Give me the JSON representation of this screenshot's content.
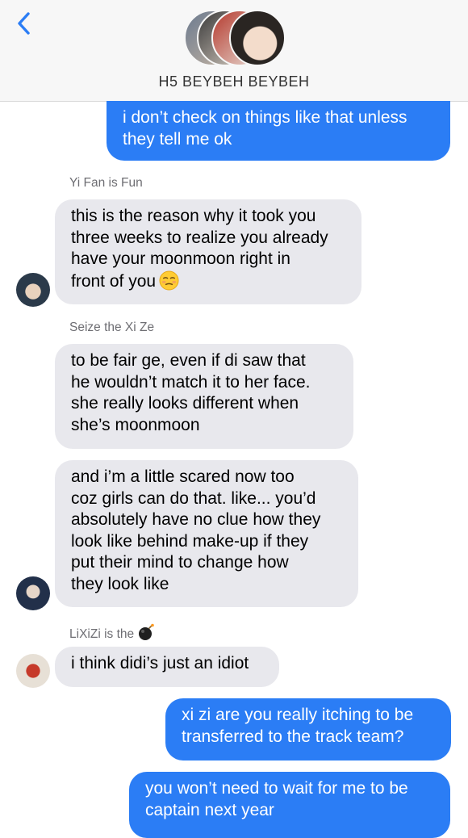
{
  "header": {
    "title": "H5 BEYBEH BEYBEH",
    "back_icon": "chevron-left-icon",
    "accent": "#2b7df5"
  },
  "messages": [
    {
      "type": "sent",
      "text": "i don’t check on things like that unless\nthey tell me ok"
    },
    {
      "type": "sender",
      "text": "Yi Fan is Fun"
    },
    {
      "type": "received",
      "text": "this is the reason why it took you\nthree weeks to realize you already\nhave your moonmoon right in\nfront of you",
      "emoji": "unamused-face-emoji"
    },
    {
      "type": "sender",
      "text": "Seize the Xi Ze"
    },
    {
      "type": "received",
      "text": "to be fair ge, even if di saw that\nhe wouldn’t match it to her face.\nshe really looks different when\nshe’s moonmoon"
    },
    {
      "type": "received",
      "text": "and i’m a little scared now too\ncoz girls can do that. like... you’d\nabsolutely have no clue how they\nlook like behind make-up if they\nput their mind to change how\nthey look like"
    },
    {
      "type": "sender",
      "text": "LiXiZi is the",
      "emoji": "bomb-emoji"
    },
    {
      "type": "received",
      "text": "i think didi’s just an idiot"
    },
    {
      "type": "sent",
      "text": "xi zi are you really itching to be\ntransferred to the track team?"
    },
    {
      "type": "sent",
      "text": "you won’t need to wait for me to be\ncaptain next year"
    }
  ],
  "colors": {
    "sent_bubble": "#2b7df5",
    "received_bubble": "#e8e8ed",
    "header_bg": "#f7f7f7"
  }
}
